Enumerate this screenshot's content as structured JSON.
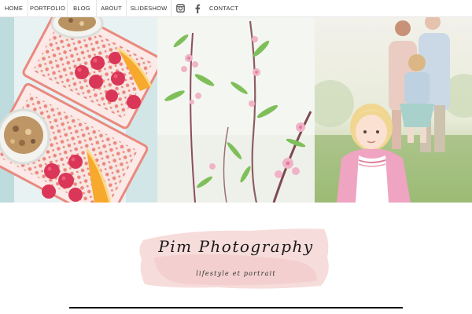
{
  "nav": {
    "items": [
      {
        "label": "HOME"
      },
      {
        "label": "PORTFOLIO"
      },
      {
        "label": "BLOG"
      },
      {
        "label": "ABOUT"
      },
      {
        "label": "SLIDESHOW"
      }
    ],
    "icons": [
      "instagram-icon",
      "facebook-icon"
    ],
    "contact_label": "CONTACT"
  },
  "brand": {
    "name": "Pim Photography",
    "tagline": "lifestyle et portrait",
    "wash_color": "#f3d3d3"
  },
  "photos": [
    {
      "subject": "raspberries-granola-oranges"
    },
    {
      "subject": "pink-blossom-branches"
    },
    {
      "subject": "child-in-pink-cardigan"
    }
  ],
  "colors": {
    "nav_text": "#333333",
    "rule": "#111111"
  }
}
